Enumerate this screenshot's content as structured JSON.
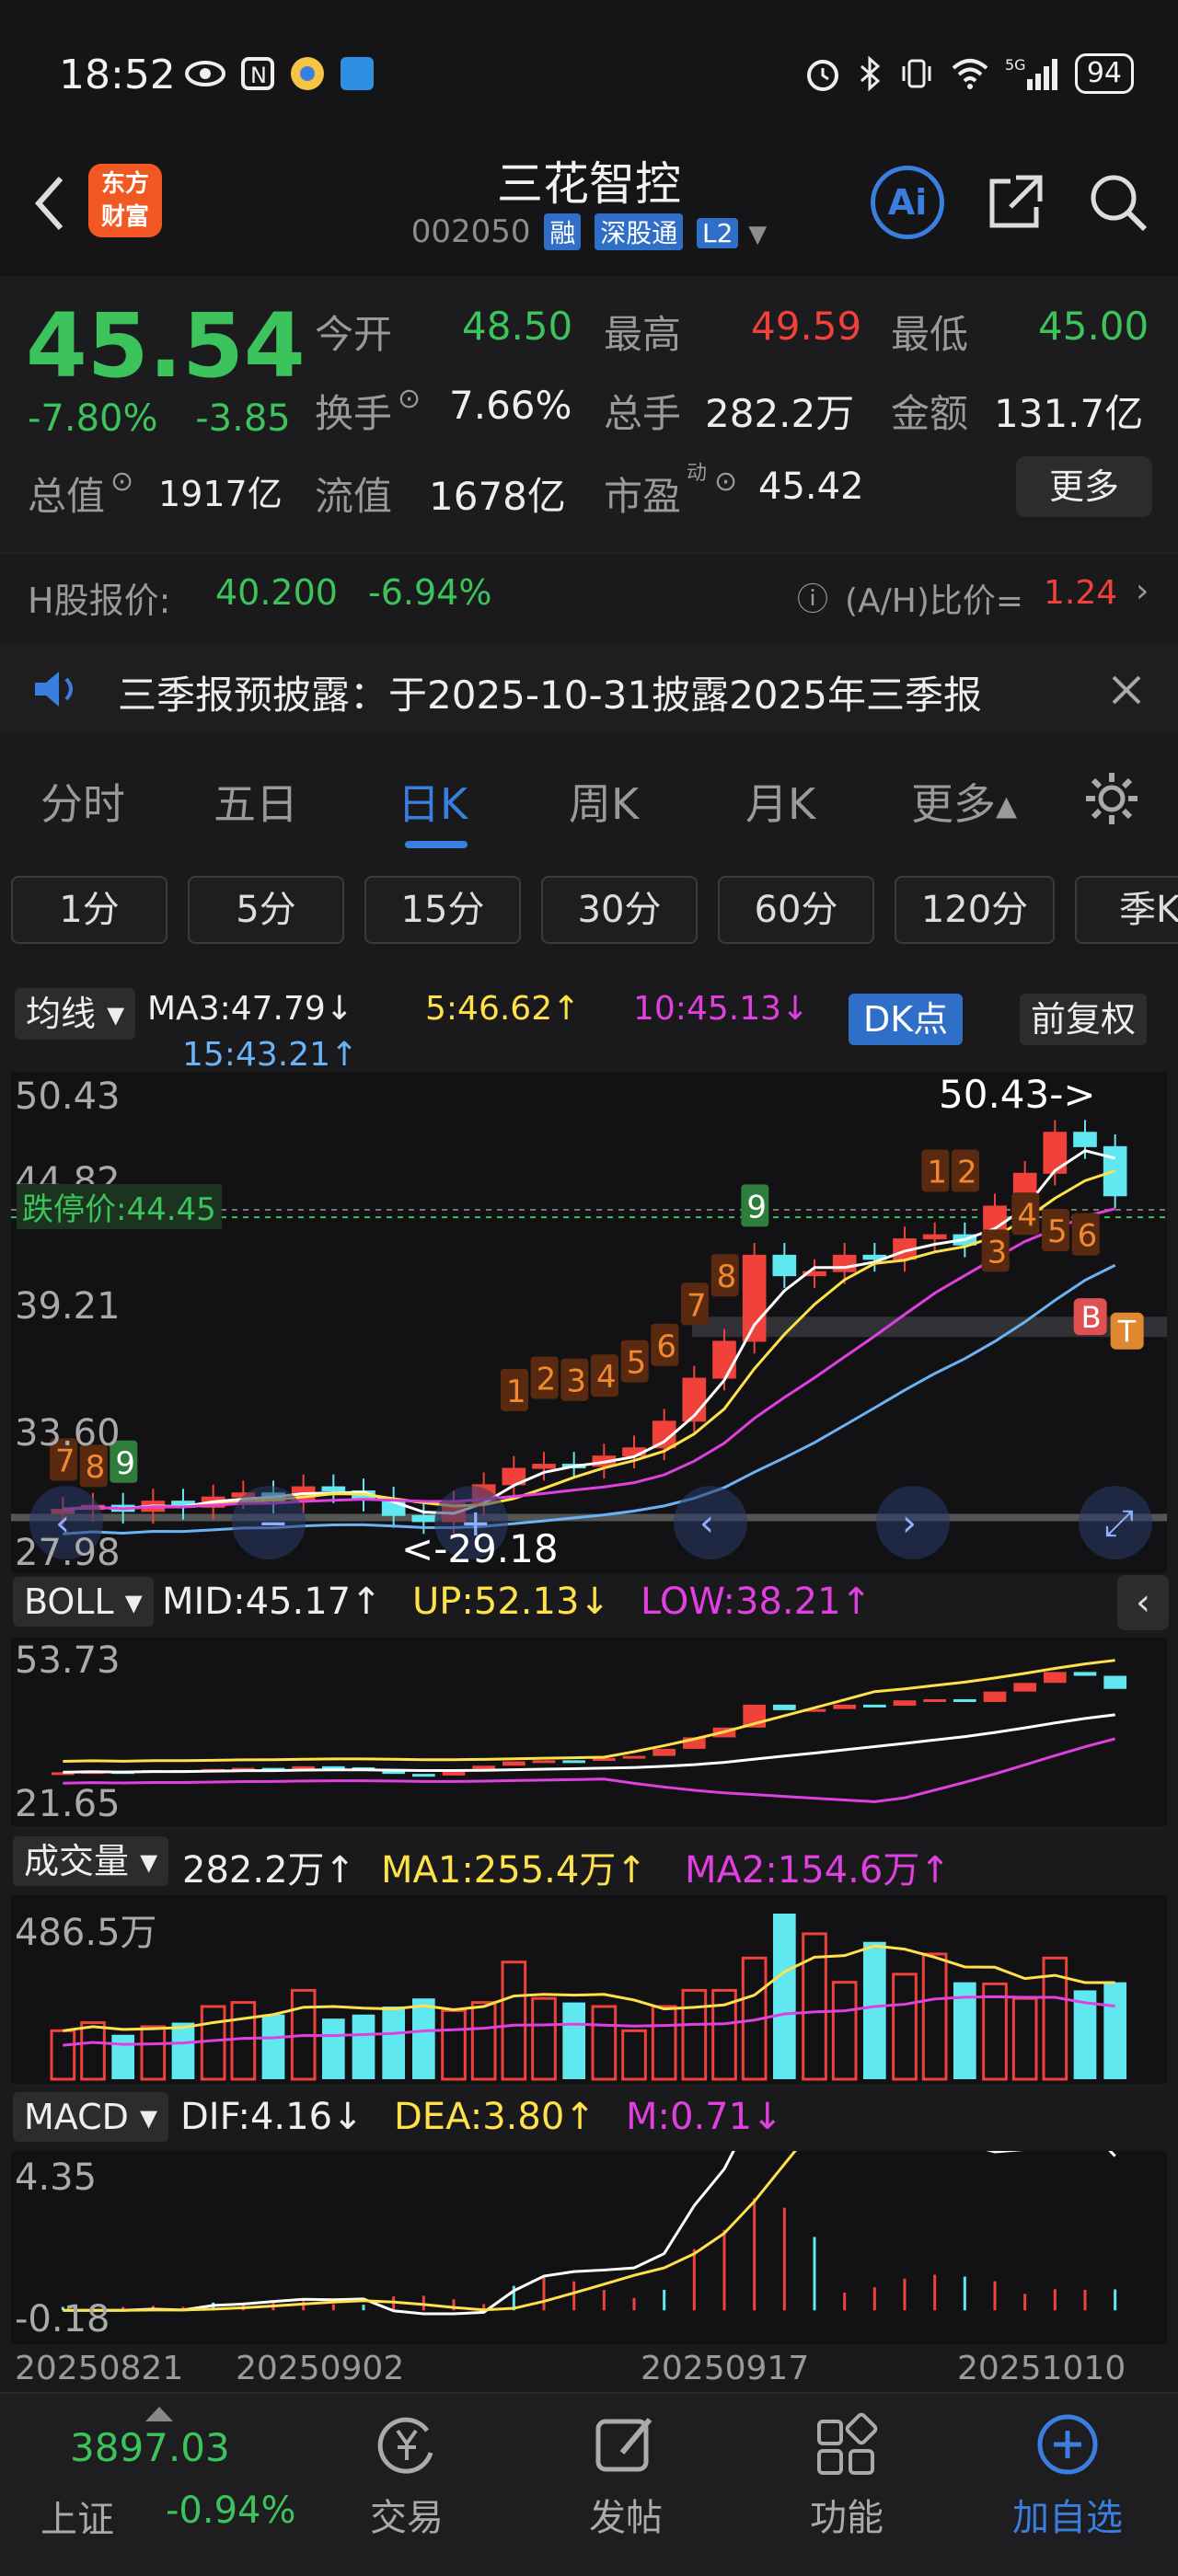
{
  "status": {
    "time": "18:52",
    "battery": "94",
    "net": "5G"
  },
  "header": {
    "title": "三花智控",
    "code": "002050",
    "tags": [
      "融",
      "深股通",
      "L2"
    ],
    "logo": "东方\n财富",
    "ai": "Ai"
  },
  "quote": {
    "price": "45.54",
    "change_pct": "-7.80%",
    "change": "-3.85",
    "open_label": "今开",
    "open": "48.50",
    "high_label": "最高",
    "high": "49.59",
    "low_label": "最低",
    "low": "45.00",
    "turnover_label": "换手",
    "turnover": "7.66%",
    "volume_label": "总手",
    "volume": "282.2万",
    "amount_label": "金额",
    "amount": "131.7亿",
    "mktcap_label": "总值",
    "mktcap": "1917亿",
    "float_label": "流值",
    "float": "1678亿",
    "pe_label": "市盈",
    "pe_sup": "动",
    "pe": "45.42",
    "more": "更多"
  },
  "hshare": {
    "label": "H股报价:",
    "price": "40.200",
    "change": "-6.94%",
    "ratio_label": "(A/H)比价=",
    "ratio": "1.24"
  },
  "notice": {
    "text": "三季报预披露：于2025-10-31披露2025年三季报"
  },
  "tabs": [
    "分时",
    "五日",
    "日K",
    "周K",
    "月K",
    "更多▴"
  ],
  "periods": [
    "1分",
    "5分",
    "15分",
    "30分",
    "60分",
    "120分",
    "季K"
  ],
  "ma": {
    "selector": "均线",
    "ma3": "MA3:47.79↓",
    "ma5": "5:46.62↑",
    "ma10": "10:45.13↓",
    "ma15": "15:43.21↑",
    "dk": "DK点",
    "fq": "前复权"
  },
  "kchart_labels": {
    "ymax": "50.43",
    "y2": "44.82",
    "y3": "39.21",
    "y4": "33.60",
    "ymin": "27.98",
    "limit": "跌停价:44.45",
    "hi_mark": "50.43->",
    "lo_mark": "<-29.18",
    "seq": [
      "7",
      "8",
      "9",
      "1",
      "2",
      "3",
      "4",
      "5",
      "6",
      "7",
      "8",
      "9",
      "1",
      "2",
      "3",
      "4",
      "5",
      "6"
    ],
    "b": "B",
    "t": "T"
  },
  "boll": {
    "selector": "BOLL",
    "mid": "MID:45.17↑",
    "up": "UP:52.13↓",
    "low": "LOW:38.21↑",
    "ymax": "53.73",
    "ymin": "21.65"
  },
  "vol": {
    "selector": "成交量",
    "vol": "282.2万↑",
    "ma1": "MA1:255.4万↑",
    "ma2": "MA2:154.6万↑",
    "ymax": "486.5万"
  },
  "macd": {
    "selector": "MACD",
    "dif": "DIF:4.16↓",
    "dea": "DEA:3.80↑",
    "m": "M:0.71↓",
    "ymax": "4.35",
    "ymin": "-0.18"
  },
  "xaxis": [
    "20250821",
    "20250902",
    "20250917",
    "20251010"
  ],
  "bottomnav": {
    "index_value": "3897.03",
    "index_name": "上证",
    "index_change": "-0.94%",
    "items": [
      "交易",
      "发帖",
      "功能",
      "加自选"
    ]
  },
  "colors": {
    "up": "#f0413a",
    "down": "#3cc35c",
    "accent": "#3a7ee0",
    "ma5": "#ffe14a",
    "ma10": "#e040e0",
    "ma15": "#6ab4f5"
  }
}
